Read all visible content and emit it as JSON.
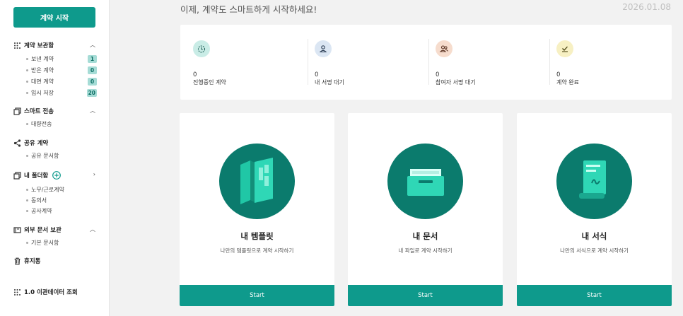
{
  "sidebar": {
    "start_button": "계약 시작",
    "sections": [
      {
        "label": "계약 보관함",
        "items": [
          {
            "label": "보낸 계약",
            "count": "1"
          },
          {
            "label": "받은 계약",
            "count": "0"
          },
          {
            "label": "대면 계약",
            "count": "0"
          },
          {
            "label": "임시 저장",
            "count": "20"
          }
        ]
      },
      {
        "label": "스마트 전송",
        "items": [
          {
            "label": "대량전송"
          }
        ]
      },
      {
        "label": "공유 계약",
        "items": [
          {
            "label": "공유 문서함"
          }
        ]
      },
      {
        "label": "내 폴더함",
        "items": [
          {
            "label": "노무/근로계약"
          },
          {
            "label": "동의서"
          },
          {
            "label": "공사계약"
          }
        ]
      },
      {
        "label": "외부 문서 보관",
        "items": [
          {
            "label": "기본 문서함"
          }
        ]
      },
      {
        "label": "휴지통"
      },
      {
        "label": "1.0 이관데이터 조회"
      }
    ]
  },
  "header": {
    "title": "이제, 계약도 스마트하게 시작하세요!",
    "date": "2026.01.08"
  },
  "status": [
    {
      "count": "0",
      "label": "진행중인 계약",
      "icon": "timer-icon",
      "color": "#c9ece6"
    },
    {
      "count": "0",
      "label": "내 서명 대기",
      "icon": "person-icon",
      "color": "#dbe6f3"
    },
    {
      "count": "0",
      "label": "참여자 서명 대기",
      "icon": "people-icon",
      "color": "#f6dccd"
    },
    {
      "count": "0",
      "label": "계약 완료",
      "icon": "check-icon",
      "color": "#f7f0c3"
    }
  ],
  "cards": [
    {
      "title": "내 템플릿",
      "desc": "나만의 템플릿으로 계약 시작하기",
      "button": "Start",
      "icon": "template-icon"
    },
    {
      "title": "내 문서",
      "desc": "내 파일로 계약 시작하기",
      "button": "Start",
      "icon": "document-tray-icon"
    },
    {
      "title": "내 서식",
      "desc": "나만의 서식으로 계약 시작하기",
      "button": "Start",
      "icon": "form-scroll-icon"
    }
  ],
  "colors": {
    "accent": "#0e9a8c",
    "circle": "#0b7b6d"
  }
}
